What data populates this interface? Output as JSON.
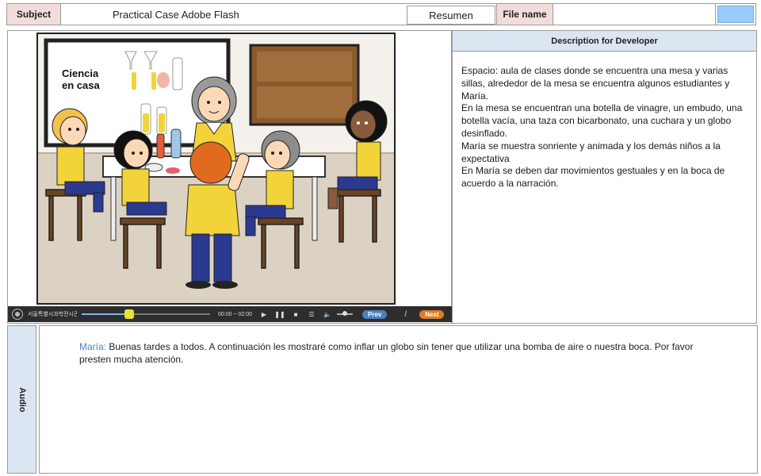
{
  "header": {
    "subject_label": "Subject",
    "subject_value": "Practical Case Adobe Flash",
    "resumen_button": "Resumen",
    "file_name_label": "File name",
    "file_name_value": ""
  },
  "scene": {
    "caption": "Ciencia\nen  casa"
  },
  "player": {
    "org_name": "서울특별시과학전시관",
    "time": "00:00 ~ 02:00",
    "progress_fraction": 0.37,
    "prev_label": "Prev",
    "separator": "/",
    "next_label": "Next"
  },
  "description": {
    "header": "Description for Developer",
    "paragraphs": [
      "Espacio: aula de clases donde se encuentra una mesa y varias sillas, alrededor de la mesa se encuentra algunos estudiantes y María.",
      "En  la mesa se encuentran una botella de vinagre, un embudo, una botella vacía, una taza con bicarbonato, una cuchara y un globo desinflado.",
      "María se muestra sonriente y animada y los demás niños a la expectativa",
      "En María se deben dar movimientos gestuales y en la boca de acuerdo a la narración."
    ]
  },
  "audio": {
    "label": "Audio",
    "speaker": "María:",
    "text": " Buenas tardes a todos. A continuación les mostraré  como inflar un globo sin tener que utilizar una bomba de aire o nuestra boca. Por favor presten mucha atención."
  },
  "colors": {
    "label_pink": "#f2dcdb",
    "panel_blue": "#dce6f2",
    "button_blue": "#99ccff",
    "speaker_blue": "#4f81bd",
    "prev_button": "#4a7fc1",
    "next_button": "#e07a22"
  }
}
